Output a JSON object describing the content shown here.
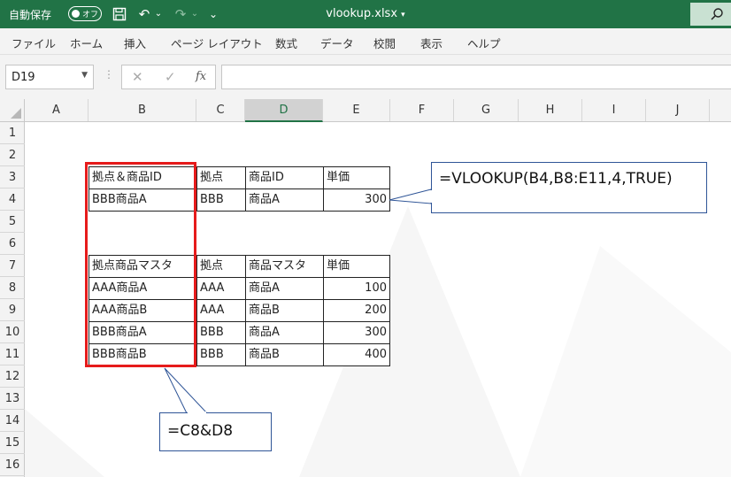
{
  "titlebar": {
    "autosave_label": "自動保存",
    "autosave_state": "オフ",
    "filename": "vlookup.xlsx"
  },
  "menu": [
    "ファイル",
    "ホーム",
    "挿入",
    "ページ レイアウト",
    "数式",
    "データ",
    "校閲",
    "表示",
    "ヘルプ"
  ],
  "formula_bar": {
    "name_box": "D19",
    "fx": "fx",
    "formula": ""
  },
  "columns": [
    "A",
    "B",
    "C",
    "D",
    "E",
    "F",
    "G",
    "H",
    "I",
    "J"
  ],
  "rows": [
    "1",
    "2",
    "3",
    "4",
    "5",
    "6",
    "7",
    "8",
    "9",
    "10",
    "11",
    "12",
    "13",
    "14",
    "15",
    "16"
  ],
  "lookup_table": {
    "headers": [
      "拠点＆商品ID",
      "拠点",
      "商品ID",
      "単価"
    ],
    "row": [
      "BBB商品A",
      "BBB",
      "商品A",
      "300"
    ]
  },
  "master_table": {
    "headers": [
      "拠点商品マスタ",
      "拠点",
      "商品マスタ",
      "単価"
    ],
    "rows": [
      [
        "AAA商品A",
        "AAA",
        "商品A",
        "100"
      ],
      [
        "AAA商品B",
        "AAA",
        "商品B",
        "200"
      ],
      [
        "BBB商品A",
        "BBB",
        "商品A",
        "300"
      ],
      [
        "BBB商品B",
        "BBB",
        "商品B",
        "400"
      ]
    ]
  },
  "callouts": {
    "vlookup_formula": "=VLOOKUP(B4,B8:E11,4,TRUE)",
    "concat_formula": "=C8&D8"
  },
  "colors": {
    "titlebar": "#217346",
    "highlight_box": "#e61b1b",
    "callout_border": "#2f5597"
  }
}
